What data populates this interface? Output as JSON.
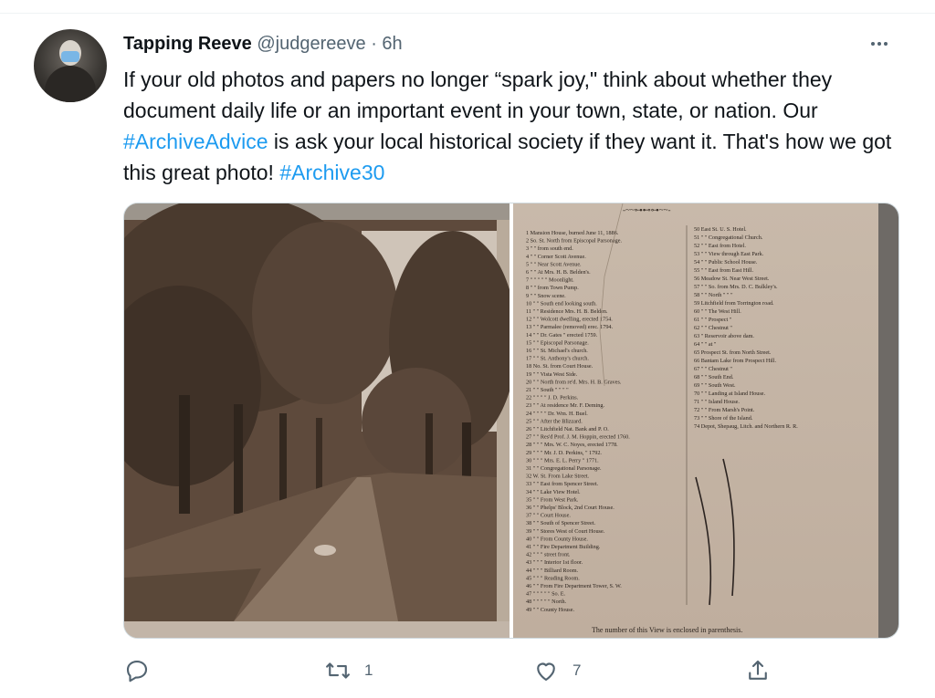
{
  "tweet": {
    "author_name": "Tapping Reeve",
    "handle": "@judgereeve",
    "separator": "·",
    "time": "6h",
    "text_1": "If your old photos and papers no longer “spark joy,\" think about whether they document daily life or an important event in your town, state, or nation. Our ",
    "hashtag_1": "#ArchiveAdvice",
    "text_2": " is ask your local historical society if they want it. That's how we got this great photo! ",
    "hashtag_2": "#Archive30"
  },
  "actions": {
    "reply_count": "",
    "retweet_count": "1",
    "like_count": "7"
  },
  "icons": {
    "more": "more-horizontal-icon",
    "reply": "reply-icon",
    "retweet": "retweet-icon",
    "like": "heart-icon",
    "share": "share-icon"
  },
  "colors": {
    "accent": "#1d9bf0",
    "secondary_text": "#536471"
  },
  "photo_text": {
    "col1": [
      "1 Mansion House, burned June 11, 1886.",
      "2 So. St. North from Episcopal Parsonage.",
      "3 \" \" from south end.",
      "4 \" \" Corner Scott Avenue.",
      "5 \" \" Near Scott Avenue.",
      "6 \" \" At Mrs. H. B. Belden's.",
      "7 \" \" \" \" \" Moonlight.",
      "8 \" \" from Town Pump.",
      "9 \" \" Snow scene.",
      "10 \" \" South end looking south.",
      "11 \" \" Residence Mrs. H. B. Belden.",
      "12 \" \" Wolcott dwelling, erected 1754.",
      "13 \" \" Parmalee (removed) erec. 1794.",
      "14 \" \" Dr. Gates \" erected 1759.",
      "15 \" \" Episcopal Parsonage.",
      "16 \" \" St. Michael's church.",
      "17 \" \" St. Anthony's church.",
      "18 No. St. from Court House.",
      "19 \" \" Vista West Side.",
      "20 \" \" North from re'd. Mrs. H. B. Graves.",
      "21 \" \" South \" \" \" \"",
      "22 \" \" \" \" J. D. Perkins.",
      "23 \" \" At residence Mr. F. Deming.",
      "24 \" \" \" \" Dr. Wm. H. Buel.",
      "25 \" \" After the Blizzard.",
      "26 \" \" Litchfield Nat. Bank and P. O.",
      "27 \" \" Res'd Prof. J. M. Hoppin, erected 1760.",
      "28 \" \" \" Mrs. W. C. Noyes, erected 1778.",
      "29 \" \" \" Mr. J. D. Perkins, \" 1792.",
      "30 \" \" \" Mrs. E. L. Perry \" 1771.",
      "31 \" \" Congregational Parsonage.",
      "32 W. St. From Lake Street.",
      "33 \" \" East from Spencer Street.",
      "34 \" \" Lake View Hotel.",
      "35 \" \" From West Park.",
      "36 \" \" Phelps' Block, 2nd Court House.",
      "37 \" \" Court House.",
      "38 \" \" South of Spencer Street.",
      "39 \" \" Stores West of Court House.",
      "40 \" \" From County House.",
      "41 \" \" Fire Department Building.",
      "42 \" \" \" street front.",
      "43 \" \" \" Interior 1st floor.",
      "44 \" \" \" Billiard Room.",
      "45 \" \" \" Reading Room.",
      "46 \" \" From Fire Department Tower, S. W.",
      "47 \" \" \" \" \" So. E.",
      "48 \" \" \" \" \" North.",
      "49 \" \" County House."
    ],
    "col2": [
      "50 East St. U. S. Hotel.",
      "51 \" \" Congregational Church.",
      "52 \" \" East from Hotel.",
      "53 \" \" View through East Park.",
      "54 \" \" Public School House.",
      "55 \" \" East from East Hill.",
      "56 Meadow St. Near West Street.",
      "57 \" \" So. from Mrs. D. C. Bulkley's.",
      "58 \" \" North \" \" \"",
      "59 Litchfield from Torrington road.",
      "60 \" \" The West Hill.",
      "61 \" \" Prospect \"",
      "62 \" \" Chestnut \"",
      "63 \" Reservoir above dam.",
      "64 \" \" at \"",
      "65 Prospect St. from North Street.",
      "66 Bantam Lake from Prospect Hill.",
      "67 \" \" Chestnut \"",
      "68 \" \" South End.",
      "69 \" \" South West.",
      "70 \" \" Landing at Island House.",
      "71 \" \" Island House.",
      "72 \" \" From Marsh's Point.",
      "73 \" \" Shore of the Island.",
      "74 Depot, Shepaug, Litch. and Northern R. R."
    ],
    "footer": "The number of this View is enclosed in parenthesis."
  }
}
